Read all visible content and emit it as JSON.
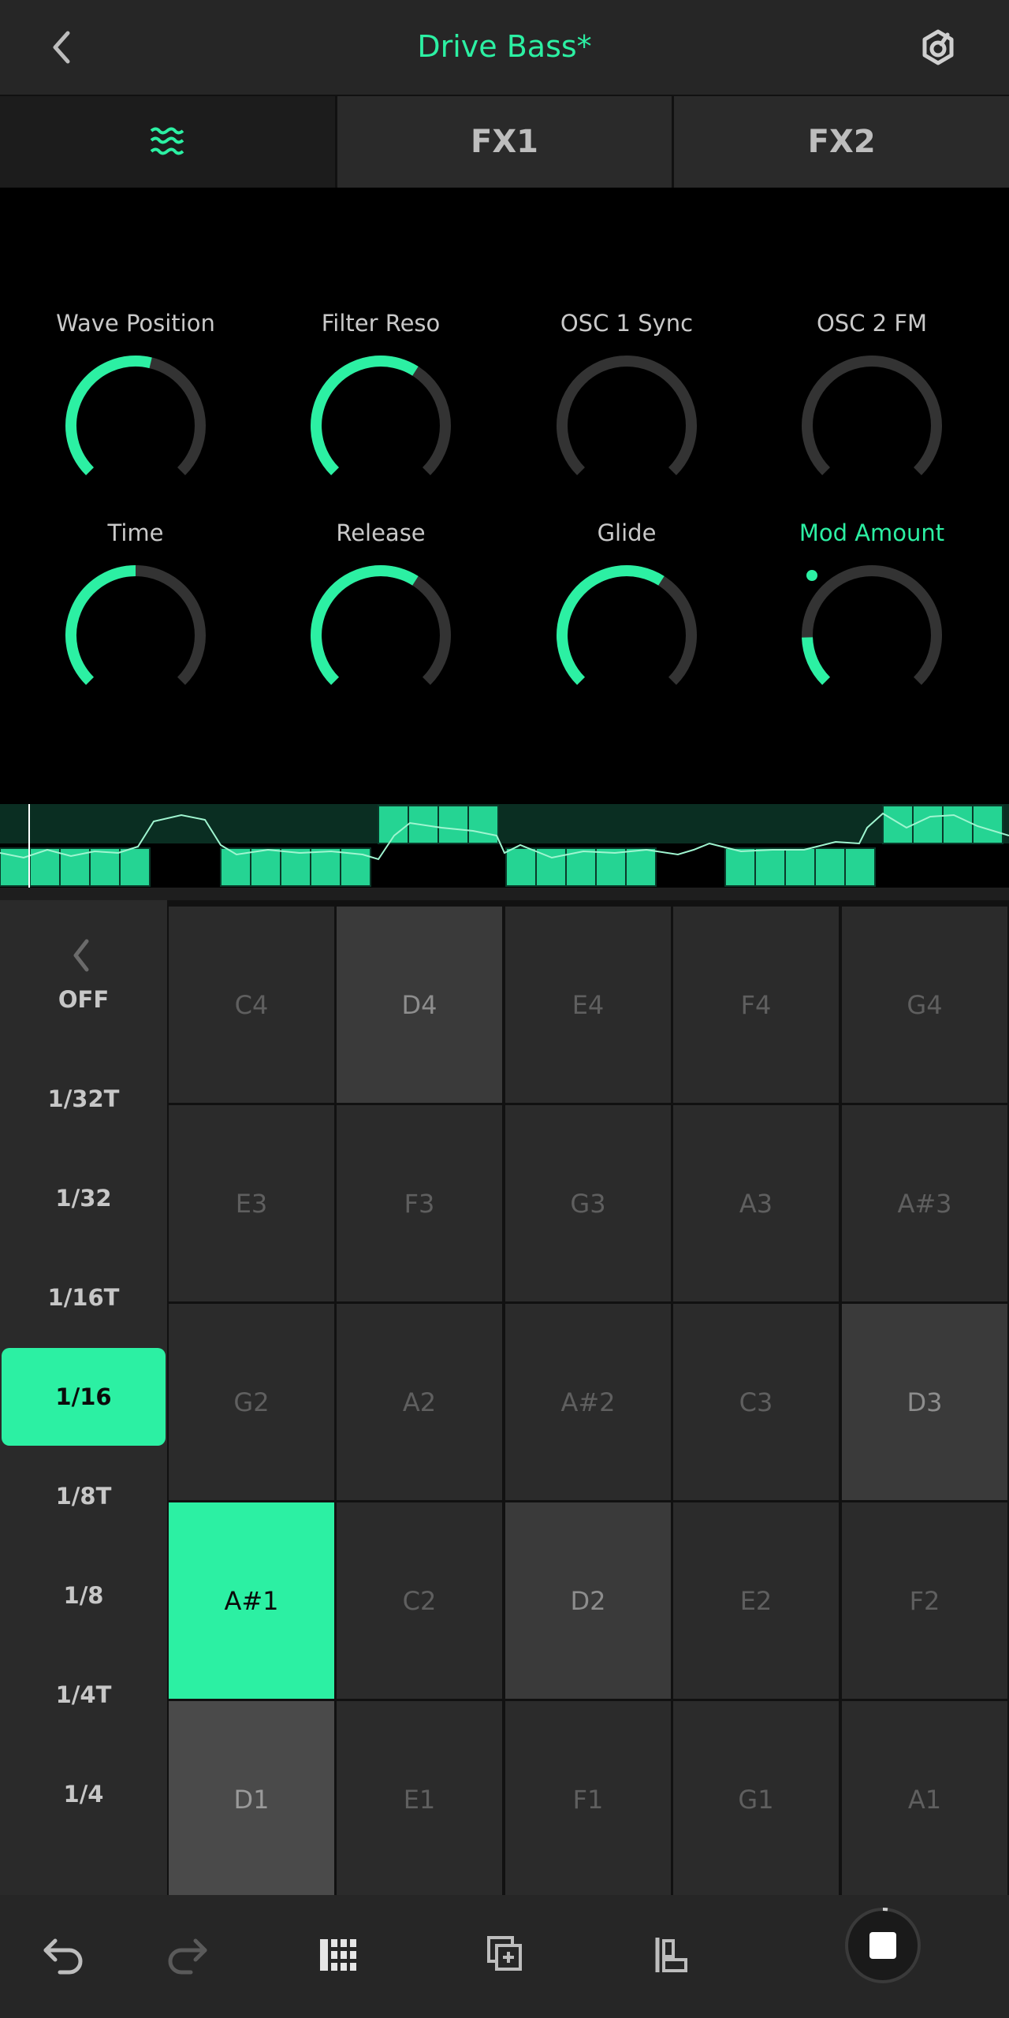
{
  "header": {
    "title": "Drive Bass*",
    "back_icon": "chevron-left-icon",
    "settings_icon": "knob-settings-icon"
  },
  "tabs": [
    {
      "label": "",
      "icon": "waves-icon",
      "active": true
    },
    {
      "label": "FX1",
      "active": false
    },
    {
      "label": "FX2",
      "active": false
    }
  ],
  "knobs": [
    {
      "label": "Wave Position",
      "value": 0.55
    },
    {
      "label": "Filter Reso",
      "value": 0.62
    },
    {
      "label": "OSC 1 Sync",
      "value": 0.0
    },
    {
      "label": "OSC 2 FM",
      "value": 0.0
    },
    {
      "label": "Time",
      "value": 0.5
    },
    {
      "label": "Release",
      "value": 0.62
    },
    {
      "label": "Glide",
      "value": 0.62
    },
    {
      "label": "Mod Amount",
      "value": 0.16,
      "highlight": true
    }
  ],
  "note_values": {
    "items": [
      "OFF",
      "1/32T",
      "1/32",
      "1/16T",
      "1/16",
      "1/8T",
      "1/8",
      "1/4T",
      "1/4"
    ],
    "selected": "1/16"
  },
  "pads": [
    [
      "C4",
      "D4",
      "E4",
      "F4",
      "G4"
    ],
    [
      "E3",
      "F3",
      "G3",
      "A3",
      "A#3"
    ],
    [
      "G2",
      "A2",
      "A#2",
      "C3",
      "D3"
    ],
    [
      "A#1",
      "C2",
      "D2",
      "E2",
      "F2"
    ],
    [
      "D1",
      "E1",
      "F1",
      "G1",
      "A1"
    ]
  ],
  "footer": {
    "icons": [
      "undo-icon",
      "redo-icon",
      "grid-view-icon",
      "duplicate-icon",
      "align-icon",
      "stop-icon"
    ]
  },
  "colors": {
    "accent": "#2cf0a3",
    "background": "#000000",
    "panel": "#262626"
  }
}
